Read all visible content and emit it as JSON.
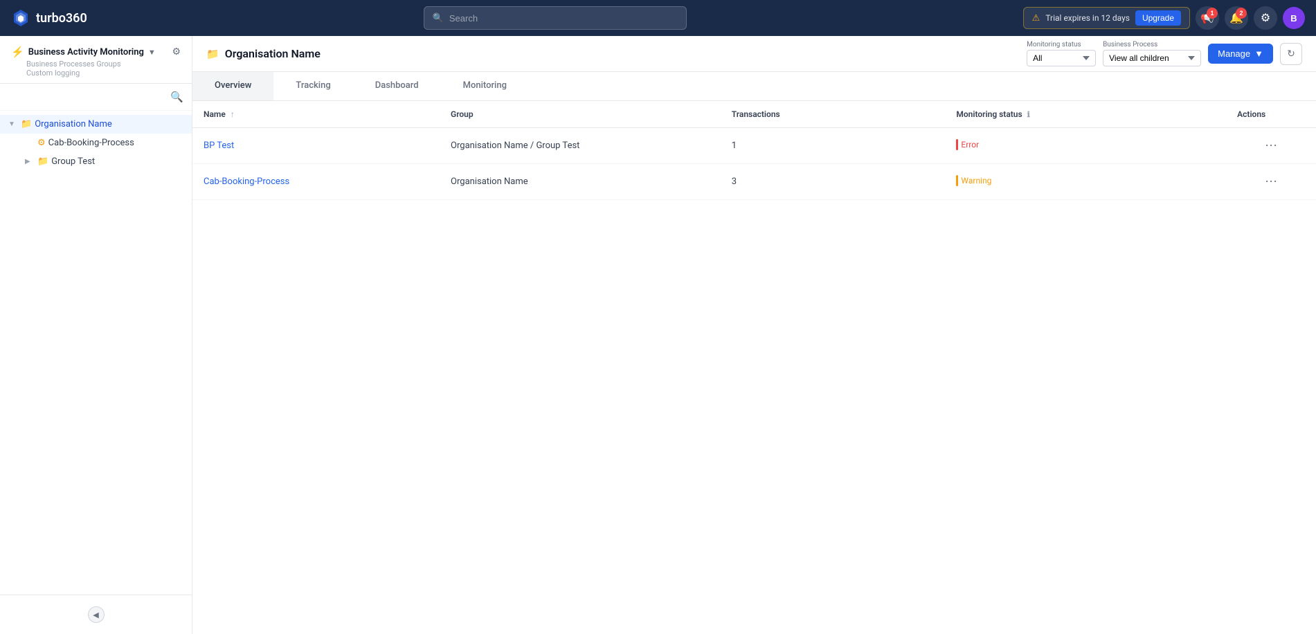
{
  "app": {
    "brand": "turbo360",
    "logo_text": "T"
  },
  "navbar": {
    "search_placeholder": "Search",
    "trial_text": "Trial expires in 12 days",
    "upgrade_label": "Upgrade",
    "notifications_count": "2",
    "announcements_count": "1",
    "avatar_initial": "B"
  },
  "sidebar": {
    "module_title": "Business Activity Monitoring",
    "section_title": "Business Processes Groups",
    "section_subtitle": "Custom logging",
    "tree_items": [
      {
        "id": "org",
        "label": "Organisation Name",
        "level": 0,
        "icon": "folder",
        "expanded": true,
        "active": true
      },
      {
        "id": "cab",
        "label": "Cab-Booking-Process",
        "level": 1,
        "icon": "bp"
      },
      {
        "id": "group",
        "label": "Group Test",
        "level": 1,
        "icon": "folder",
        "expanded": false
      }
    ]
  },
  "header": {
    "page_icon": "folder",
    "page_title": "Organisation Name",
    "monitoring_status_label": "Monitoring status",
    "monitoring_status_value": "All",
    "business_process_label": "Business Process",
    "business_process_value": "View all children",
    "manage_label": "Manage",
    "refresh_icon": "refresh"
  },
  "tabs": [
    {
      "id": "overview",
      "label": "Overview",
      "active": true
    },
    {
      "id": "tracking",
      "label": "Tracking",
      "active": false
    },
    {
      "id": "dashboard",
      "label": "Dashboard",
      "active": false
    },
    {
      "id": "monitoring",
      "label": "Monitoring",
      "active": false
    }
  ],
  "table": {
    "columns": [
      {
        "id": "name",
        "label": "Name",
        "sortable": true
      },
      {
        "id": "group",
        "label": "Group",
        "sortable": false
      },
      {
        "id": "transactions",
        "label": "Transactions",
        "sortable": false
      },
      {
        "id": "monitoring_status",
        "label": "Monitoring status",
        "info": true
      },
      {
        "id": "actions",
        "label": "Actions",
        "sortable": false
      }
    ],
    "rows": [
      {
        "id": "row1",
        "name": "BP Test",
        "name_link": true,
        "group": "Organisation Name / Group Test",
        "transactions": "1",
        "monitoring_status": "Error",
        "monitoring_status_type": "error"
      },
      {
        "id": "row2",
        "name": "Cab-Booking-Process",
        "name_link": true,
        "group": "Organisation Name",
        "transactions": "3",
        "monitoring_status": "Warning",
        "monitoring_status_type": "warning"
      }
    ]
  }
}
